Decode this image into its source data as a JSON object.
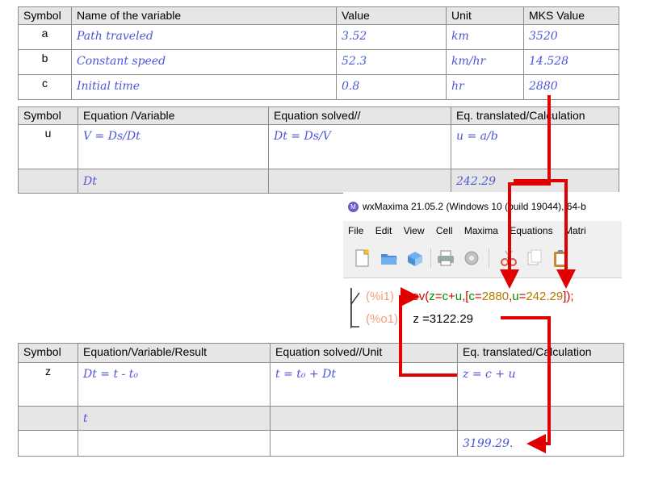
{
  "table1": {
    "headers": [
      "Symbol",
      "Name of the variable",
      "Value",
      "Unit",
      "MKS Value"
    ],
    "rows": [
      {
        "symbol": "a",
        "name": "Path traveled",
        "value": "3.52",
        "unit": "km",
        "mks": "3520"
      },
      {
        "symbol": "b",
        "name": "Constant speed",
        "value": "52.3",
        "unit": "km/hr",
        "mks": "14.528"
      },
      {
        "symbol": "c",
        "name": "Initial time",
        "value": "0.8",
        "unit": "hr",
        "mks": "2880"
      }
    ]
  },
  "table2": {
    "headers": [
      "Symbol",
      "Equation /Variable",
      "Equation solved//",
      "Eq. translated/Calculation"
    ],
    "rows": [
      {
        "symbol": "u",
        "eq": "V = Ds/Dt",
        "solved": "Dt = Ds/V",
        "calc": "u = a/b"
      },
      {
        "symbol": "",
        "eq": "Dt",
        "solved": "",
        "calc": "242.29"
      }
    ]
  },
  "wxmaxima": {
    "title": "wxMaxima 21.05.2 (Windows 10 (build 19044), 64-b",
    "menu": [
      "File",
      "Edit",
      "View",
      "Cell",
      "Maxima",
      "Equations",
      "Matri"
    ],
    "input_label": "(%i1)",
    "input_fn": "ev(",
    "input_z": "z",
    "input_eq1": "=",
    "input_c": "c",
    "input_plus": "+",
    "input_u": "u",
    "input_open": ",[",
    "input_c2": "c",
    "input_eq2": "=",
    "input_val1": "2880",
    "input_comma": ",",
    "input_u2": "u",
    "input_eq3": "=",
    "input_val2": "242.29",
    "input_close": "]);",
    "output_label": "(%o1)",
    "output_value": "z =3122.29"
  },
  "table3": {
    "headers": [
      "Symbol",
      "Equation/Variable/Result",
      "Equation solved//Unit",
      "Eq. translated/Calculation"
    ],
    "rows": [
      {
        "symbol": "z",
        "eq": "Dt = t - t₀",
        "solved": "t = t₀ + Dt",
        "calc": "z = c + u"
      },
      {
        "symbol": "",
        "eq": "t",
        "solved": "",
        "calc": ""
      },
      {
        "symbol": "",
        "eq": "",
        "solved": "",
        "calc": "3199.29."
      }
    ]
  },
  "colors": {
    "arrow": "#e00000",
    "handwriting": "#4b55d8",
    "header_bg": "#e6e6e6"
  }
}
